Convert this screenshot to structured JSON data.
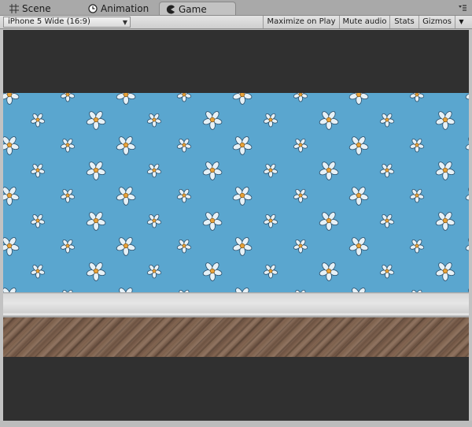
{
  "tabs": [
    {
      "label": "Scene",
      "icon": "grid-icon",
      "active": false
    },
    {
      "label": "Animation",
      "icon": "clock-icon",
      "active": false
    },
    {
      "label": "Game",
      "icon": "pacman-icon",
      "active": true
    }
  ],
  "toolbar": {
    "aspect_dropdown": "iPhone 5 Wide (16:9)",
    "maximize_label": "Maximize on Play",
    "mute_label": "Mute audio",
    "stats_label": "Stats",
    "gizmos_label": "Gizmos"
  },
  "colors": {
    "wallpaper": "#5aa6cf",
    "flower_petal": "#e6f1f7",
    "flower_center": "#e8a23a",
    "letterbox": "#303030"
  }
}
